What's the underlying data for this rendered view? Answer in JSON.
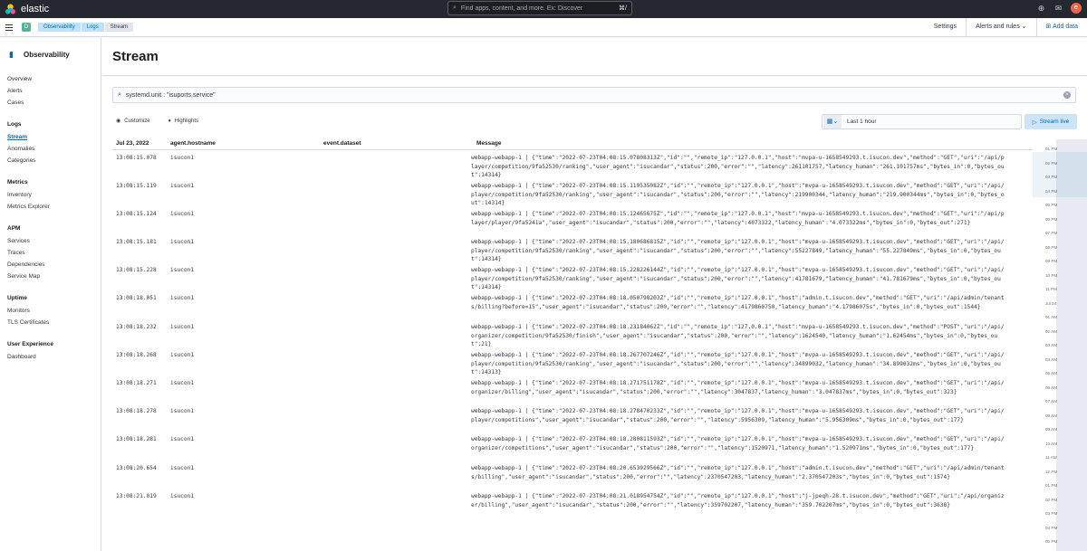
{
  "topbar": {
    "brand": "elastic",
    "search_placeholder": "Find apps, content, and more. Ex: Discover",
    "search_shortcut": "⌘/",
    "avatar_initial": "e"
  },
  "subbar": {
    "breadcrumbs": [
      "Observability",
      "Logs",
      "Stream"
    ],
    "settings": "Settings",
    "alerts": "Alerts and rules",
    "add_data": "Add data"
  },
  "sidebar": {
    "title": "Observability",
    "items_top": [
      "Overview",
      "Alerts",
      "Cases"
    ],
    "logs_title": "Logs",
    "logs_items": [
      "Stream",
      "Anomalies",
      "Categories"
    ],
    "metrics_title": "Metrics",
    "metrics_items": [
      "Inventory",
      "Metrics Explorer"
    ],
    "apm_title": "APM",
    "apm_items": [
      "Services",
      "Traces",
      "Dependencies",
      "Service Map"
    ],
    "uptime_title": "Uptime",
    "uptime_items": [
      "Monitors",
      "TLS Certificates"
    ],
    "ux_title": "User Experience",
    "ux_items": [
      "Dashboard"
    ]
  },
  "page": {
    "title": "Stream",
    "query": "systemd.unit : \"isuports.service\"",
    "customize": "Customize",
    "highlights": "Highlights",
    "date_range": "Last 1 hour",
    "stream_live": "Stream live"
  },
  "table": {
    "columns": [
      "Jul 23, 2022",
      "agent.hostname",
      "event.dataset",
      "Message"
    ],
    "rows": [
      {
        "time": "13:08:15.078",
        "host": "isucon1",
        "msg": "webapp-webapp-1  | {\"time\":\"2022-07-23T04:08:15.07808313Z\",\"id\":\"\",\"remote_ip\":\"127.0.0.1\",\"host\":\"mvpa-u-1658549293.t.isucon.dev\",\"method\":\"GET\",\"uri\":\"/api/player/competition/9fa52530/ranking\",\"user_agent\":\"isucandar\",\"status\":200,\"error\":\"\",\"latency\":261101757,\"latency_human\":\"261.101757ms\",\"bytes_in\":0,\"bytes_out\":14314}"
      },
      {
        "time": "13:08:15.119",
        "host": "isucon1",
        "msg": "webapp-webapp-1  | {\"time\":\"2022-07-23T04:08:15.119535082Z\",\"id\":\"\",\"remote_ip\":\"127.0.0.1\",\"host\":\"mvpa-u-1658549293.t.isucon.dev\",\"method\":\"GET\",\"uri\":\"/api/player/competition/9fa52530/ranking\",\"user_agent\":\"isucandar\",\"status\":200,\"error\":\"\",\"latency\":219900344,\"latency_human\":\"219.900344ms\",\"bytes_in\":0,\"bytes_out\":14314}"
      },
      {
        "time": "13:08:15.124",
        "host": "isucon1",
        "msg": "webapp-webapp-1  | {\"time\":\"2022-07-23T04:08:15.12465675Z\",\"id\":\"\",\"remote_ip\":\"127.0.0.1\",\"host\":\"mvpa-u-1658549293.t.isucon.dev\",\"method\":\"GET\",\"uri\":\"/api/player/player/9fa5241a\",\"user_agent\":\"isucandar\",\"status\":200,\"error\":\"\",\"latency\":4073322,\"latency_human\":\"4.073322ms\",\"bytes_in\":0,\"bytes_out\":271}"
      },
      {
        "time": "13:08:15.181",
        "host": "isucon1",
        "msg": "webapp-webapp-1  | {\"time\":\"2022-07-23T04:08:15.180686815Z\",\"id\":\"\",\"remote_ip\":\"127.0.0.1\",\"host\":\"mvpa-u-1658549293.t.isucon.dev\",\"method\":\"GET\",\"uri\":\"/api/player/competition/9fa52530/ranking\",\"user_agent\":\"isucandar\",\"status\":200,\"error\":\"\",\"latency\":55227849,\"latency_human\":\"55.227849ms\",\"bytes_in\":0,\"bytes_out\":14314}"
      },
      {
        "time": "13:08:15.228",
        "host": "isucon1",
        "msg": "webapp-webapp-1  | {\"time\":\"2022-07-23T04:08:15.228226144Z\",\"id\":\"\",\"remote_ip\":\"127.0.0.1\",\"host\":\"mvpa-u-1658549293.t.isucon.dev\",\"method\":\"GET\",\"uri\":\"/api/player/competition/9fa52530/ranking\",\"user_agent\":\"isucandar\",\"status\":200,\"error\":\"\",\"latency\":41781679,\"latency_human\":\"41.781679ms\",\"bytes_in\":0,\"bytes_out\":14314}"
      },
      {
        "time": "13:08:18.051",
        "host": "isucon1",
        "msg": "webapp-webapp-1  | {\"time\":\"2022-07-23T04:08:18.050798203Z\",\"id\":\"\",\"remote_ip\":\"127.0.0.1\",\"host\":\"admin.t.isucon.dev\",\"method\":\"GET\",\"uri\":\"/api/admin/tenants/billing?before=15\",\"user_agent\":\"isucandar\",\"status\":200,\"error\":\"\",\"latency\":4179860750,\"latency_human\":\"4.17986075s\",\"bytes_in\":0,\"bytes_out\":1544}"
      },
      {
        "time": "13:08:18.232",
        "host": "isucon1",
        "msg": "webapp-webapp-1  | {\"time\":\"2022-07-23T04:08:18.23184062Z\",\"id\":\"\",\"remote_ip\":\"127.0.0.1\",\"host\":\"mvpa-u-1658549293.t.isucon.dev\",\"method\":\"POST\",\"uri\":\"/api/organizer/competition/9fa52530/finish\",\"user_agent\":\"isucandar\",\"status\":200,\"error\":\"\",\"latency\":1624540,\"latency_human\":\"1.62454ms\",\"bytes_in\":0,\"bytes_out\":21}"
      },
      {
        "time": "13:08:18.268",
        "host": "isucon1",
        "msg": "webapp-webapp-1  | {\"time\":\"2022-07-23T04:08:18.267707246Z\",\"id\":\"\",\"remote_ip\":\"127.0.0.1\",\"host\":\"mvpa-u-1658549293.t.isucon.dev\",\"method\":\"GET\",\"uri\":\"/api/player/competition/9fa52530/ranking\",\"user_agent\":\"isucandar\",\"status\":200,\"error\":\"\",\"latency\":34899032,\"latency_human\":\"34.899032ms\",\"bytes_in\":0,\"bytes_out\":14313}"
      },
      {
        "time": "13:08:18.271",
        "host": "isucon1",
        "msg": "webapp-webapp-1  | {\"time\":\"2022-07-23T04:08:18.271751178Z\",\"id\":\"\",\"remote_ip\":\"127.0.0.1\",\"host\":\"mvpa-u-1658549293.t.isucon.dev\",\"method\":\"GET\",\"uri\":\"/api/organizer/billing\",\"user_agent\":\"isucandar\",\"status\":200,\"error\":\"\",\"latency\":3047837,\"latency_human\":\"3.047837ms\",\"bytes_in\":0,\"bytes_out\":323}"
      },
      {
        "time": "13:08:18.278",
        "host": "isucon1",
        "msg": "webapp-webapp-1  | {\"time\":\"2022-07-23T04:08:18.278470233Z\",\"id\":\"\",\"remote_ip\":\"127.0.0.1\",\"host\":\"mvpa-u-1658549293.t.isucon.dev\",\"method\":\"GET\",\"uri\":\"/api/player/competitions\",\"user_agent\":\"isucandar\",\"status\":200,\"error\":\"\",\"latency\":5956309,\"latency_human\":\"5.956309ms\",\"bytes_in\":0,\"bytes_out\":177}"
      },
      {
        "time": "13:08:18.281",
        "host": "isucon1",
        "msg": "webapp-webapp-1  | {\"time\":\"2022-07-23T04:08:18.280811593Z\",\"id\":\"\",\"remote_ip\":\"127.0.0.1\",\"host\":\"mvpa-u-1658549293.t.isucon.dev\",\"method\":\"GET\",\"uri\":\"/api/organizer/competitions\",\"user_agent\":\"isucandar\",\"status\":200,\"error\":\"\",\"latency\":1520971,\"latency_human\":\"1.520971ms\",\"bytes_in\":0,\"bytes_out\":177}"
      },
      {
        "time": "13:08:20.654",
        "host": "isucon1",
        "msg": "webapp-webapp-1  | {\"time\":\"2022-07-23T04:08:20.653929566Z\",\"id\":\"\",\"remote_ip\":\"127.0.0.1\",\"host\":\"admin.t.isucon.dev\",\"method\":\"GET\",\"uri\":\"/api/admin/tenants/billing\",\"user_agent\":\"isucandar\",\"status\":200,\"error\":\"\",\"latency\":2370547203,\"latency_human\":\"2.370547203s\",\"bytes_in\":0,\"bytes_out\":1574}"
      },
      {
        "time": "13:08:21.019",
        "host": "isucon1",
        "msg": "webapp-webapp-1  | {\"time\":\"2022-07-23T04:08:21.018954754Z\",\"id\":\"\",\"remote_ip\":\"127.0.0.1\",\"host\":\"j-jpeqh-28.t.isucon.dev\",\"method\":\"GET\",\"uri\":\"/api/organizer/billing\",\"user_agent\":\"isucandar\",\"status\":200,\"error\":\"\",\"latency\":359702207,\"latency_human\":\"359.702207ms\",\"bytes_in\":0,\"bytes_out\":3638}"
      }
    ]
  },
  "minimap": {
    "ticks": [
      "01 PM",
      "02 PM",
      "03 PM",
      "04 PM",
      "05 PM",
      "06 PM",
      "07 PM",
      "08 PM",
      "09 PM",
      "10 PM",
      "11 PM",
      "Jul 24",
      "01 AM",
      "02 AM",
      "03 AM",
      "04 AM",
      "05 AM",
      "06 AM",
      "07 AM",
      "08 AM",
      "09 AM",
      "10 AM",
      "11 AM",
      "12 PM",
      "01 PM",
      "02 PM",
      "03 PM",
      "04 PM",
      "05 PM"
    ]
  },
  "colors": {
    "topbar": "#25282f",
    "accent": "#006bb8",
    "app_badge": "#54b399"
  }
}
